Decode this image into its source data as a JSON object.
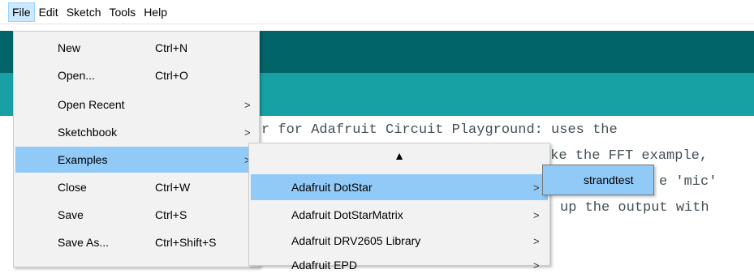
{
  "menubar": {
    "items": [
      "File",
      "Edit",
      "Sketch",
      "Tools",
      "Help"
    ]
  },
  "editor": {
    "lines": [
      "r for Adafruit Circuit Playground: uses the",
      "ike the FFT example,",
      "e 'mic'",
      "up the output with"
    ]
  },
  "file_menu": {
    "items": [
      {
        "label": "New",
        "shortcut": "Ctrl+N"
      },
      {
        "label": "Open...",
        "shortcut": "Ctrl+O"
      },
      {
        "label": "Open Recent",
        "arrow": ">"
      },
      {
        "label": "Sketchbook",
        "arrow": ">"
      },
      {
        "label": "Examples",
        "arrow": ">"
      },
      {
        "label": "Close",
        "shortcut": "Ctrl+W"
      },
      {
        "label": "Save",
        "shortcut": "Ctrl+S"
      },
      {
        "label": "Save As...",
        "shortcut": "Ctrl+Shift+S"
      }
    ]
  },
  "examples_menu": {
    "scroll_up": "▲",
    "items": [
      {
        "label": "Adafruit DotStar",
        "arrow": ">"
      },
      {
        "label": "Adafruit DotStarMatrix",
        "arrow": ">"
      },
      {
        "label": "Adafruit DRV2605 Library",
        "arrow": ">"
      },
      {
        "label": "Adafruit EPD",
        "arrow": ">"
      }
    ]
  },
  "dotstar_menu": {
    "items": [
      {
        "label": "strandtest"
      }
    ]
  },
  "colors": {
    "toolbar": "#006468",
    "tab_band": "#17a1a5",
    "highlight": "#91c9f7",
    "menu_bg": "#f2f2f2"
  }
}
